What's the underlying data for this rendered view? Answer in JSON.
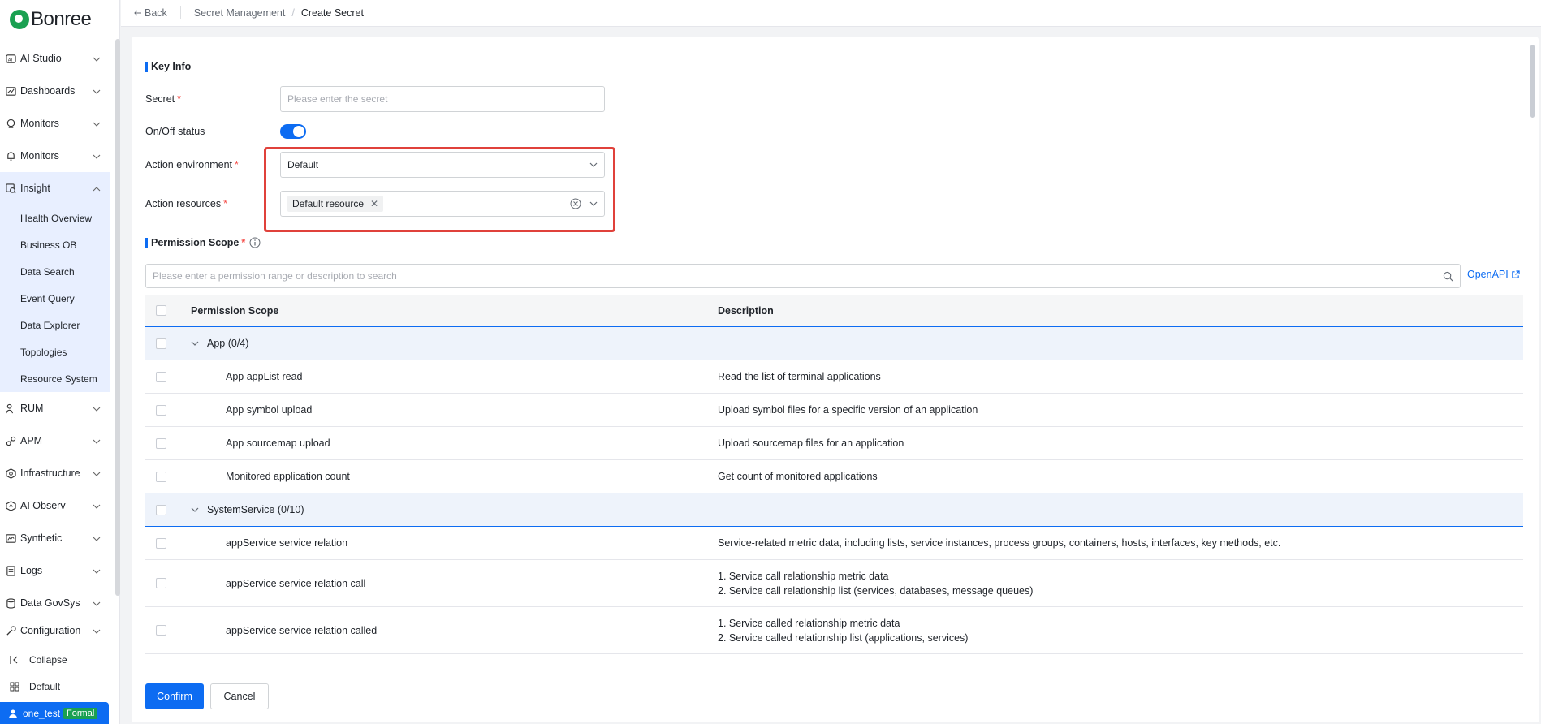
{
  "brand": {
    "name": "Bonree"
  },
  "sidebar": {
    "items": [
      {
        "label": "AI Studio",
        "icon": "ai-studio-icon"
      },
      {
        "label": "Dashboards",
        "icon": "dashboard-icon"
      },
      {
        "label": "Monitors",
        "icon": "monitor-icon"
      },
      {
        "label": "Monitors",
        "icon": "monitor-bell-icon"
      },
      {
        "label": "Insight",
        "icon": "insight-icon",
        "expanded": true,
        "children": [
          "Health Overview",
          "Business OB",
          "Data Search",
          "Event Query",
          "Data Explorer",
          "Topologies",
          "Resource System"
        ]
      },
      {
        "label": "RUM",
        "icon": "rum-icon"
      },
      {
        "label": "APM",
        "icon": "apm-icon"
      },
      {
        "label": "Infrastructure",
        "icon": "infrastructure-icon"
      },
      {
        "label": "AI Observ",
        "icon": "ai-observ-icon"
      },
      {
        "label": "Synthetic",
        "icon": "synthetic-icon"
      },
      {
        "label": "Logs",
        "icon": "logs-icon"
      },
      {
        "label": "Data GovSys",
        "icon": "data-govsys-icon"
      },
      {
        "label": "Configuration",
        "icon": "configuration-icon"
      }
    ],
    "collapse_label": "Collapse",
    "workspace_label": "Default",
    "user": {
      "name": "one_test",
      "badge": "Formal"
    }
  },
  "header": {
    "back_label": "Back",
    "breadcrumb_parent": "Secret Management",
    "breadcrumb_separator": "/",
    "breadcrumb_current": "Create Secret"
  },
  "form": {
    "key_info_title": "Key Info",
    "secret_label": "Secret",
    "secret_placeholder": "Please enter the secret",
    "status_label": "On/Off status",
    "status_on": true,
    "env_label": "Action environment",
    "env_value": "Default",
    "resources_label": "Action resources",
    "resource_tag": "Default resource",
    "required_mark": "*"
  },
  "permission": {
    "title": "Permission Scope",
    "search_placeholder": "Please enter a permission range or description to search",
    "openapi_label": "OpenAPI",
    "columns": {
      "scope": "Permission Scope",
      "description": "Description"
    },
    "groups": [
      {
        "name": "App (0/4)",
        "rows": [
          {
            "scope": "App appList read",
            "desc1": "Read the list of terminal applications",
            "desc2": ""
          },
          {
            "scope": "App symbol upload",
            "desc1": "Upload symbol files for a specific version of an application",
            "desc2": ""
          },
          {
            "scope": "App sourcemap upload",
            "desc1": "Upload sourcemap files for an application",
            "desc2": ""
          },
          {
            "scope": "Monitored application count",
            "desc1": "Get count of monitored applications",
            "desc2": ""
          }
        ]
      },
      {
        "name": "SystemService (0/10)",
        "rows": [
          {
            "scope": "appService service relation",
            "desc1": "Service-related metric data, including lists, service instances, process groups, containers, hosts, interfaces, key methods, etc.",
            "desc2": ""
          },
          {
            "scope": "appService service relation call",
            "desc1": "1. Service call relationship metric data",
            "desc2": "2. Service call relationship list (services, databases, message queues)"
          },
          {
            "scope": "appService service relation called",
            "desc1": "1. Service called relationship metric data",
            "desc2": "2. Service called relationship list (applications, services)"
          }
        ]
      }
    ]
  },
  "footer": {
    "confirm_label": "Confirm",
    "cancel_label": "Cancel"
  },
  "colors": {
    "primary": "#0d6cf2",
    "required": "#f54a45",
    "highlight_box": "#e0413b",
    "badge": "#1aa051"
  }
}
